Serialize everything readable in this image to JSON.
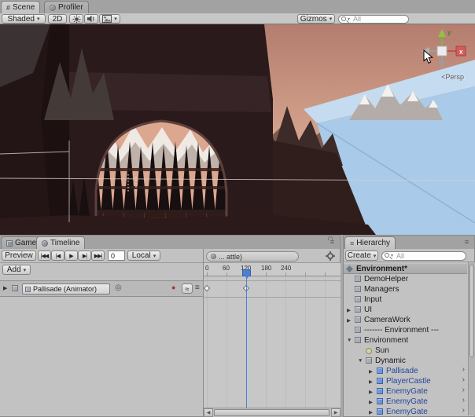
{
  "top_tabs": {
    "scene": "Scene",
    "profiler": "Profiler"
  },
  "scene_toolbar": {
    "shaded": "Shaded",
    "mode_2d": "2D",
    "gizmos": "Gizmos",
    "search_placeholder": "All"
  },
  "scene_view": {
    "persp_label": "<Persp",
    "axis_y_label": "y",
    "axis_x_label": "x"
  },
  "timeline": {
    "game_tab": "Game",
    "timeline_tab": "Timeline",
    "preview_label": "Preview",
    "frame_value": "0",
    "ref_mode": "Local",
    "add_label": "Add",
    "clip_header": "... attle)",
    "track_name": "Pallisade (Animator)",
    "ruler_ticks": [
      "0",
      "60",
      "120",
      "180",
      "240"
    ]
  },
  "hierarchy": {
    "tab": "Hierarchy",
    "create_label": "Create",
    "search_placeholder": "All",
    "items": [
      {
        "label": "Environment*"
      },
      {
        "label": "DemoHelper"
      },
      {
        "label": "Managers"
      },
      {
        "label": "Input"
      },
      {
        "label": "UI"
      },
      {
        "label": "CameraWork"
      },
      {
        "label": "------- Environment ---"
      },
      {
        "label": "Environment"
      },
      {
        "label": "Sun"
      },
      {
        "label": "Dynamic"
      },
      {
        "label": "Pallisade"
      },
      {
        "label": "PlayerCastle"
      },
      {
        "label": "EnemyGate"
      },
      {
        "label": "EnemyGate"
      },
      {
        "label": "EnemyGate"
      }
    ]
  },
  "icons": {
    "dropdown": "▾",
    "expander_open": "▼",
    "expander_closed": "▶",
    "prefab_arrow": "›",
    "record": "●",
    "menu": "≡",
    "curves": "≈",
    "circle": "◎",
    "fold": "▶",
    "scroll_left": "◀",
    "scroll_right": "▶",
    "corner_plus": "+",
    "scene_tab_hash": "#",
    "transport_start": "|◀◀",
    "transport_prev": "|◀",
    "transport_play": "▶",
    "transport_next": "▶|",
    "transport_end": "▶▶|"
  }
}
